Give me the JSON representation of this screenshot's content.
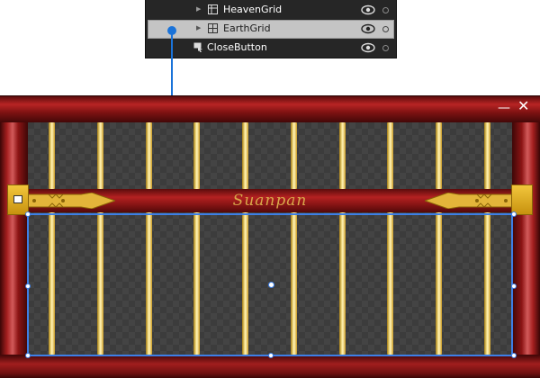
{
  "layers": [
    {
      "label": "HeavenGrid",
      "icon": "grid-icon",
      "selected": false,
      "has_children": true
    },
    {
      "label": "EarthGrid",
      "icon": "grid-icon",
      "selected": true,
      "has_children": true
    },
    {
      "label": "CloseButton",
      "icon": "button-icon",
      "selected": false,
      "has_children": false
    }
  ],
  "window": {
    "title": "Suanpan",
    "minimize_glyph": "—",
    "close_glyph": "✕"
  },
  "colors": {
    "frame": "#8c1515",
    "rod": "#e9c95a",
    "accent": "#d9a84a",
    "selection": "#3d7fe6",
    "panel_bg": "#262626"
  }
}
